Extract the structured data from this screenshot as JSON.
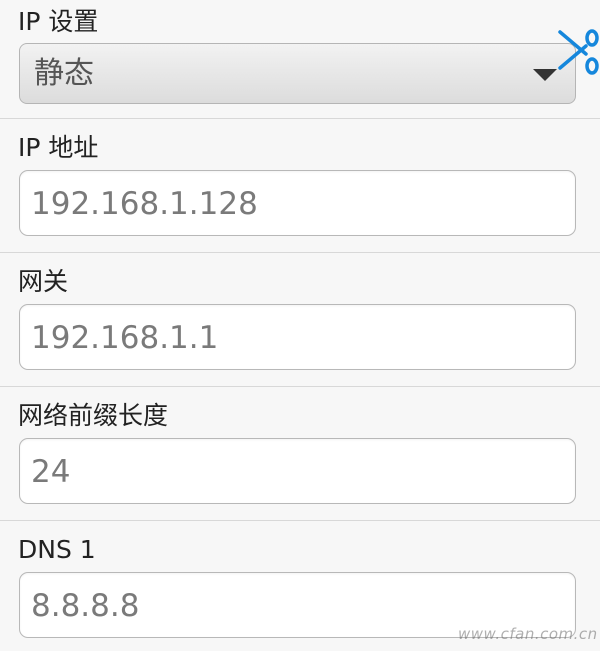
{
  "ip_settings": {
    "label": "IP 设置",
    "selected_value": "静态"
  },
  "fields": [
    {
      "label": "IP 地址",
      "value": "192.168.1.128"
    },
    {
      "label": "网关",
      "value": "192.168.1.1"
    },
    {
      "label": "网络前缀长度",
      "value": "24"
    },
    {
      "label": "DNS 1",
      "value": "8.8.8.8"
    }
  ],
  "watermark": "www.cfan.com.cn",
  "colors": {
    "background": "#f7f7f7",
    "field_border": "#b8b8b8",
    "field_text": "#7a7a7a",
    "label_text": "#222222",
    "scissors_blue": "#1587dc"
  },
  "icons": {
    "dropdown_arrow": "dropdown-arrow-icon",
    "scissors": "scissors-icon"
  }
}
